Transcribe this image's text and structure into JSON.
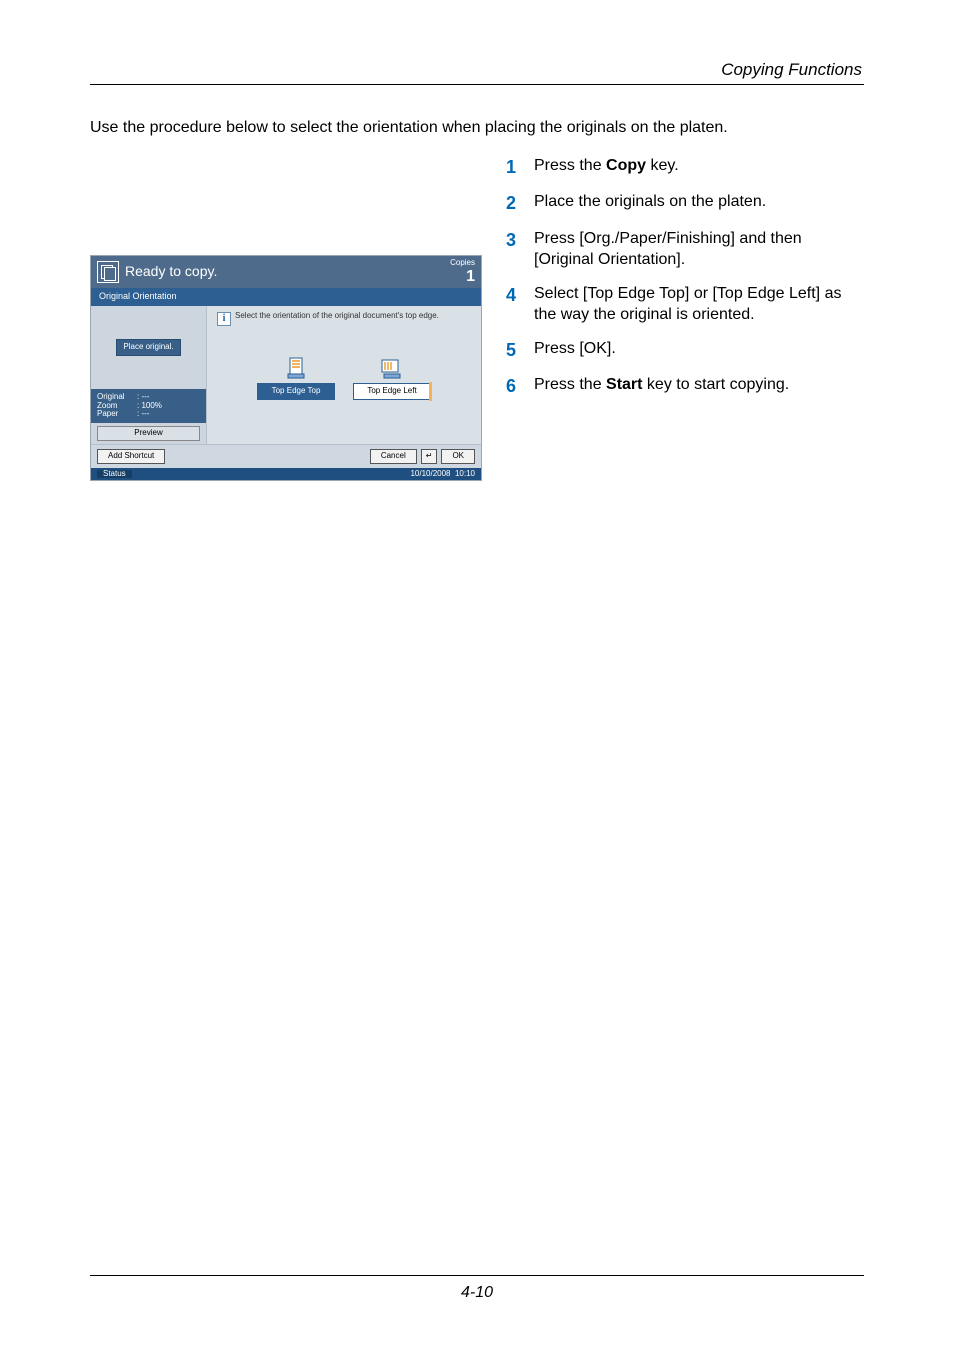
{
  "header": {
    "section": "Copying Functions"
  },
  "intro": "Use the procedure below to select the orientation when placing the originals on the platen.",
  "steps": [
    {
      "n": "1",
      "a": "Press the ",
      "b": "Copy",
      "c": " key."
    },
    {
      "n": "2",
      "a": "Place the originals on the platen."
    },
    {
      "n": "3",
      "a": "Press [Org./Paper/Finishing] and then [Original Orientation]."
    },
    {
      "n": "4",
      "a": "Select [Top Edge Top] or [Top Edge Left] as the way the original is oriented."
    },
    {
      "n": "5",
      "a": "Press [OK]."
    },
    {
      "n": "6",
      "a": "Press the ",
      "b": "Start",
      "c": " key to start copying."
    }
  ],
  "panel": {
    "title": "Ready to copy.",
    "copies_label": "Copies",
    "copies_count": "1",
    "tab": "Original Orientation",
    "hint": "Select the orientation of the original document's top edge.",
    "left": {
      "place_original": "Place original.",
      "info": [
        {
          "k": "Original",
          "v": ": ---"
        },
        {
          "k": "Zoom",
          "v": ": 100%"
        },
        {
          "k": "Paper",
          "v": ": ---"
        }
      ],
      "preview": "Preview"
    },
    "options": [
      {
        "label": "Top Edge Top",
        "selected": true
      },
      {
        "label": "Top Edge Left",
        "selected": false
      }
    ],
    "buttons": {
      "add_shortcut": "Add Shortcut",
      "cancel": "Cancel",
      "back": "↵",
      "ok": "OK"
    },
    "status": {
      "label": "Status",
      "date": "10/10/2008",
      "time": "10:10"
    }
  },
  "footer": {
    "page": "4-10"
  }
}
